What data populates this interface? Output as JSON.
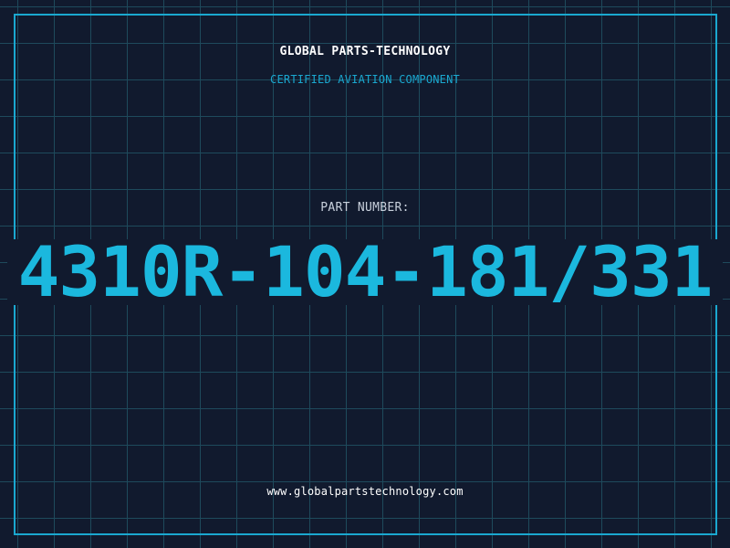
{
  "header": {
    "company": "GLOBAL PARTS-TECHNOLOGY",
    "subtitle": "CERTIFIED AVIATION COMPONENT"
  },
  "part": {
    "label": "PART NUMBER:",
    "number": "4310R-104-181/331"
  },
  "footer": {
    "website": "www.globalpartstechnology.com"
  },
  "colors": {
    "background": "#111a2e",
    "grid": "#1e4a5c",
    "accent": "#1aa8d0",
    "part_number": "#1bb8de",
    "text": "#ffffff"
  }
}
